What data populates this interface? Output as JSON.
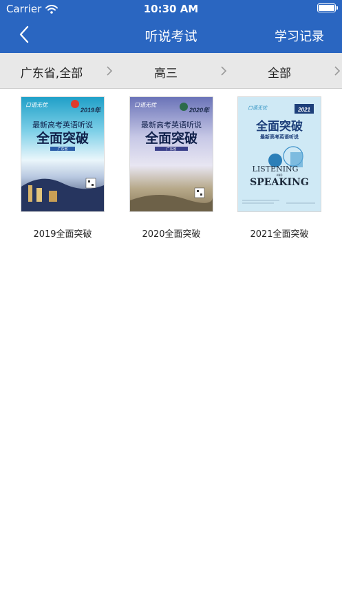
{
  "status_bar": {
    "carrier": "Carrier",
    "time": "10:30 AM"
  },
  "nav": {
    "title": "听说考试",
    "right_label": "学习记录"
  },
  "filters": [
    {
      "label": "广东省,全部"
    },
    {
      "label": "高三"
    },
    {
      "label": "全部"
    }
  ],
  "books": [
    {
      "title": "2019全面突破",
      "cover": {
        "brand": "口语无忧",
        "year": "2019年",
        "line1": "最新高考英语听说",
        "line2": "全面突破",
        "region": "广东省"
      }
    },
    {
      "title": "2020全面突破",
      "cover": {
        "brand": "口语无忧",
        "year": "2020年",
        "line1": "最新高考英语听说",
        "line2": "全面突破",
        "region": "广东省"
      }
    },
    {
      "title": "2021全面突破",
      "cover": {
        "brand": "口语无忧",
        "year": "2021",
        "line1": "全面突破",
        "line2": "最新高考英语听说",
        "en1": "LISTENING",
        "en_and": "AND",
        "en2": "SPEAKING"
      }
    }
  ],
  "colors": {
    "nav_bg": "#2a66c1",
    "filter_bg": "#e8e8e8"
  },
  "icons": {
    "back": "chevron-left-icon",
    "filter_chevron": "chevron-right-icon"
  }
}
